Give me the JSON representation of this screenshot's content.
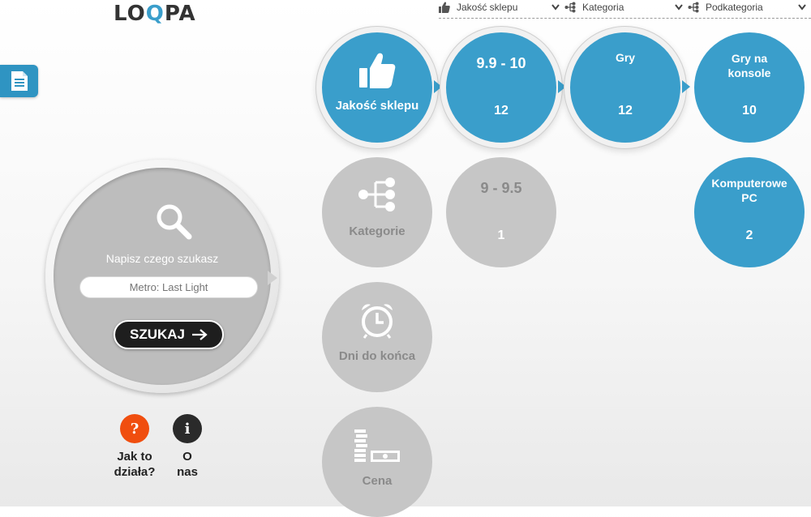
{
  "logo": {
    "part1": "LO",
    "part2": "Q",
    "part3": "PA"
  },
  "filters": [
    {
      "label": "Jakość sklepu",
      "icon": "thumbs-up-icon"
    },
    {
      "label": "Kategoria",
      "icon": "tree-icon"
    },
    {
      "label": "Podkategoria",
      "icon": "tree-icon"
    }
  ],
  "search": {
    "label": "Napisz czego szukasz",
    "placeholder": "Metro: Last Light",
    "button_label": "SZUKAJ"
  },
  "help": {
    "question_symbol": "?",
    "question_label_1": "Jak to",
    "question_label_2": "działa?",
    "info_symbol": "i",
    "info_label_1": "O",
    "info_label_2": "nas"
  },
  "nav_bubbles": {
    "quality": "Jakość sklepu",
    "categories": "Kategorie",
    "days": "Dni do końca",
    "price": "Cena"
  },
  "result_bubbles": {
    "range_high": {
      "title": "9.9 - 10",
      "count": "12"
    },
    "games": {
      "title": "Gry",
      "count": "12"
    },
    "console_games": {
      "title_1": "Gry na",
      "title_2": "konsole",
      "count": "10"
    },
    "range_low": {
      "title": "9 - 9.5",
      "count": "1"
    },
    "pc": {
      "title_1": "Komputerowe",
      "title_2": "PC",
      "count": "2"
    }
  },
  "colors": {
    "accent": "#3a9ecb",
    "inactive": "#c6c6c6",
    "help_orange": "#f04e0f",
    "info_dark": "#2a2a2a"
  }
}
